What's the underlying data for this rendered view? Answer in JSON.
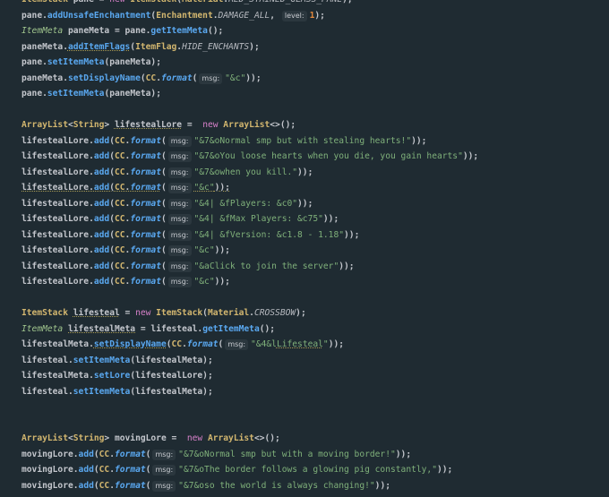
{
  "editor": {
    "lines": [
      [
        [
          "ItemStack",
          "ty"
        ],
        [
          " pane = ",
          "p"
        ],
        [
          "new",
          "kw"
        ],
        [
          " ItemStack",
          "ty"
        ],
        [
          "(",
          "p"
        ],
        [
          "Material",
          "ty"
        ],
        [
          ".",
          "p"
        ],
        [
          "RED_STAINED_GLASS_PANE",
          "ic"
        ],
        [
          ");",
          "p"
        ]
      ],
      [
        [
          "pane.",
          "p"
        ],
        [
          "addUnsafeEnchantment",
          "m"
        ],
        [
          "(",
          "p"
        ],
        [
          "Enchantment",
          "ty"
        ],
        [
          ".",
          "p"
        ],
        [
          "DAMAGE_ALL",
          "ic"
        ],
        [
          ", ",
          "p"
        ],
        [
          "level:",
          "h"
        ],
        [
          "1",
          "n"
        ],
        [
          ");",
          "p"
        ]
      ],
      [
        [
          "ItemMeta",
          "ti"
        ],
        [
          " paneMeta = pane.",
          "p"
        ],
        [
          "getItemMeta",
          "m"
        ],
        [
          "();",
          "p"
        ]
      ],
      [
        [
          "paneMeta.",
          "p"
        ],
        [
          "addItemFlags",
          "m u"
        ],
        [
          "(",
          "p"
        ],
        [
          "ItemFlag",
          "ty"
        ],
        [
          ".",
          "p"
        ],
        [
          "HIDE_ENCHANTS",
          "ic"
        ],
        [
          ");",
          "p"
        ]
      ],
      [
        [
          "pane.",
          "p"
        ],
        [
          "setItemMeta",
          "m"
        ],
        [
          "(paneMeta);",
          "p"
        ]
      ],
      [
        [
          "paneMeta.",
          "p"
        ],
        [
          "setDisplayName",
          "m"
        ],
        [
          "(",
          "p"
        ],
        [
          "CC",
          "ty"
        ],
        [
          ".",
          "p"
        ],
        [
          "format",
          "f"
        ],
        [
          "(",
          "p"
        ],
        [
          "msg:",
          "h"
        ],
        [
          "\"&c\"",
          "s"
        ],
        [
          "));",
          "p"
        ]
      ],
      [
        [
          "pane.",
          "p"
        ],
        [
          "setItemMeta",
          "m"
        ],
        [
          "(paneMeta);",
          "p"
        ]
      ],
      [],
      [
        [
          "ArrayList",
          "ty"
        ],
        [
          "<",
          "p"
        ],
        [
          "String",
          "ty"
        ],
        [
          "> ",
          "p"
        ],
        [
          "lifestealLore",
          "p u"
        ],
        [
          " =  ",
          "p"
        ],
        [
          "new",
          "kw"
        ],
        [
          " ArrayList",
          "ty"
        ],
        [
          "<>();",
          "p"
        ]
      ],
      [
        [
          "lifestealLore.",
          "p"
        ],
        [
          "add",
          "m"
        ],
        [
          "(",
          "p"
        ],
        [
          "CC",
          "ty"
        ],
        [
          ".",
          "p"
        ],
        [
          "format",
          "f"
        ],
        [
          "(",
          "p"
        ],
        [
          "msg:",
          "h"
        ],
        [
          "\"&7&oNormal smp but with stealing hearts!\"",
          "s"
        ],
        [
          "));",
          "p"
        ]
      ],
      [
        [
          "lifestealLore.",
          "p"
        ],
        [
          "add",
          "m"
        ],
        [
          "(",
          "p"
        ],
        [
          "CC",
          "ty"
        ],
        [
          ".",
          "p"
        ],
        [
          "format",
          "f"
        ],
        [
          "(",
          "p"
        ],
        [
          "msg:",
          "h"
        ],
        [
          "\"&7&oYou loose hearts when you die, you gain hearts\"",
          "s"
        ],
        [
          "));",
          "p"
        ]
      ],
      [
        [
          "lifestealLore.",
          "p"
        ],
        [
          "add",
          "m"
        ],
        [
          "(",
          "p"
        ],
        [
          "CC",
          "ty"
        ],
        [
          ".",
          "p"
        ],
        [
          "format",
          "f"
        ],
        [
          "(",
          "p"
        ],
        [
          "msg:",
          "h"
        ],
        [
          "\"&7&owhen you kill.\"",
          "s"
        ],
        [
          "));",
          "p"
        ]
      ],
      [
        [
          "lifestealLore.",
          "p u"
        ],
        [
          "add",
          "m u"
        ],
        [
          "(",
          "p u"
        ],
        [
          "CC",
          "ty u"
        ],
        [
          ".",
          "p u"
        ],
        [
          "format",
          "f u"
        ],
        [
          "(",
          "p"
        ],
        [
          "msg:",
          "h"
        ],
        [
          "\"&c\"",
          "s u"
        ],
        [
          "));",
          "p u"
        ]
      ],
      [
        [
          "lifestealLore.",
          "p"
        ],
        [
          "add",
          "m"
        ],
        [
          "(",
          "p"
        ],
        [
          "CC",
          "ty"
        ],
        [
          ".",
          "p"
        ],
        [
          "format",
          "f"
        ],
        [
          "(",
          "p"
        ],
        [
          "msg:",
          "h"
        ],
        [
          "\"&4| &fPlayers: &c0\"",
          "s"
        ],
        [
          "));",
          "p"
        ]
      ],
      [
        [
          "lifestealLore.",
          "p"
        ],
        [
          "add",
          "m"
        ],
        [
          "(",
          "p"
        ],
        [
          "CC",
          "ty"
        ],
        [
          ".",
          "p"
        ],
        [
          "format",
          "f"
        ],
        [
          "(",
          "p"
        ],
        [
          "msg:",
          "h"
        ],
        [
          "\"&4| &fMax Players: &c75\"",
          "s"
        ],
        [
          "));",
          "p"
        ]
      ],
      [
        [
          "lifestealLore.",
          "p"
        ],
        [
          "add",
          "m"
        ],
        [
          "(",
          "p"
        ],
        [
          "CC",
          "ty"
        ],
        [
          ".",
          "p"
        ],
        [
          "format",
          "f"
        ],
        [
          "(",
          "p"
        ],
        [
          "msg:",
          "h"
        ],
        [
          "\"&4| &fVersion: &c1.8 - 1.18\"",
          "s"
        ],
        [
          "));",
          "p"
        ]
      ],
      [
        [
          "lifestealLore.",
          "p"
        ],
        [
          "add",
          "m"
        ],
        [
          "(",
          "p"
        ],
        [
          "CC",
          "ty"
        ],
        [
          ".",
          "p"
        ],
        [
          "format",
          "f"
        ],
        [
          "(",
          "p"
        ],
        [
          "msg:",
          "h"
        ],
        [
          "\"&c\"",
          "s"
        ],
        [
          "));",
          "p"
        ]
      ],
      [
        [
          "lifestealLore.",
          "p"
        ],
        [
          "add",
          "m"
        ],
        [
          "(",
          "p"
        ],
        [
          "CC",
          "ty"
        ],
        [
          ".",
          "p"
        ],
        [
          "format",
          "f"
        ],
        [
          "(",
          "p"
        ],
        [
          "msg:",
          "h"
        ],
        [
          "\"&aClick to join the server\"",
          "s"
        ],
        [
          "));",
          "p"
        ]
      ],
      [
        [
          "lifestealLore.",
          "p"
        ],
        [
          "add",
          "m"
        ],
        [
          "(",
          "p"
        ],
        [
          "CC",
          "ty"
        ],
        [
          ".",
          "p"
        ],
        [
          "format",
          "f"
        ],
        [
          "(",
          "p"
        ],
        [
          "msg:",
          "h"
        ],
        [
          "\"&c\"",
          "s"
        ],
        [
          "));",
          "p"
        ]
      ],
      [],
      [
        [
          "ItemStack",
          "ty"
        ],
        [
          " ",
          "p"
        ],
        [
          "lifesteal",
          "p u"
        ],
        [
          " = ",
          "p"
        ],
        [
          "new",
          "kw"
        ],
        [
          " ItemStack",
          "ty"
        ],
        [
          "(",
          "p"
        ],
        [
          "Material",
          "ty"
        ],
        [
          ".",
          "p"
        ],
        [
          "CROSSBOW",
          "ic"
        ],
        [
          ");",
          "p"
        ]
      ],
      [
        [
          "ItemMeta",
          "ti"
        ],
        [
          " ",
          "p"
        ],
        [
          "lifestealMeta",
          "p u"
        ],
        [
          " = lifesteal.",
          "p"
        ],
        [
          "getItemMeta",
          "m"
        ],
        [
          "();",
          "p"
        ]
      ],
      [
        [
          "lifestealMeta.",
          "p"
        ],
        [
          "setDisplayName",
          "m u"
        ],
        [
          "(",
          "p"
        ],
        [
          "CC",
          "ty"
        ],
        [
          ".",
          "p"
        ],
        [
          "format",
          "f"
        ],
        [
          "(",
          "p"
        ],
        [
          "msg:",
          "h"
        ],
        [
          "\"&4&l",
          "s"
        ],
        [
          "Lifesteal",
          "s u"
        ],
        [
          "\"",
          "s"
        ],
        [
          "));",
          "p"
        ]
      ],
      [
        [
          "lifesteal.",
          "p"
        ],
        [
          "setItemMeta",
          "m"
        ],
        [
          "(lifestealMeta);",
          "p"
        ]
      ],
      [
        [
          "lifestealMeta.",
          "p"
        ],
        [
          "setLore",
          "m"
        ],
        [
          "(lifestealLore);",
          "p"
        ]
      ],
      [
        [
          "lifesteal.",
          "p"
        ],
        [
          "setItemMeta",
          "m"
        ],
        [
          "(lifestealMeta);",
          "p"
        ]
      ],
      [],
      [],
      [
        [
          "ArrayList",
          "ty"
        ],
        [
          "<",
          "p"
        ],
        [
          "String",
          "ty"
        ],
        [
          "> movingLore =  ",
          "p"
        ],
        [
          "new",
          "kw"
        ],
        [
          " ArrayList",
          "ty"
        ],
        [
          "<>();",
          "p"
        ]
      ],
      [
        [
          "movingLore.",
          "p"
        ],
        [
          "add",
          "m"
        ],
        [
          "(",
          "p"
        ],
        [
          "CC",
          "ty"
        ],
        [
          ".",
          "p"
        ],
        [
          "format",
          "f"
        ],
        [
          "(",
          "p"
        ],
        [
          "msg:",
          "h"
        ],
        [
          "\"&7&oNormal smp but with a moving border!\"",
          "s"
        ],
        [
          "));",
          "p"
        ]
      ],
      [
        [
          "movingLore.",
          "p"
        ],
        [
          "add",
          "m"
        ],
        [
          "(",
          "p"
        ],
        [
          "CC",
          "ty"
        ],
        [
          ".",
          "p"
        ],
        [
          "format",
          "f"
        ],
        [
          "(",
          "p"
        ],
        [
          "msg:",
          "h"
        ],
        [
          "\"&7&oThe border follows a glowing pig constantly,\"",
          "s"
        ],
        [
          "));",
          "p"
        ]
      ],
      [
        [
          "movingLore.",
          "p"
        ],
        [
          "add",
          "m"
        ],
        [
          "(",
          "p"
        ],
        [
          "CC",
          "ty"
        ],
        [
          ".",
          "p"
        ],
        [
          "format",
          "f"
        ],
        [
          "(",
          "p"
        ],
        [
          "msg:",
          "h"
        ],
        [
          "\"&7&oso the world is always changing!\"",
          "s"
        ],
        [
          "));",
          "p"
        ]
      ]
    ]
  }
}
